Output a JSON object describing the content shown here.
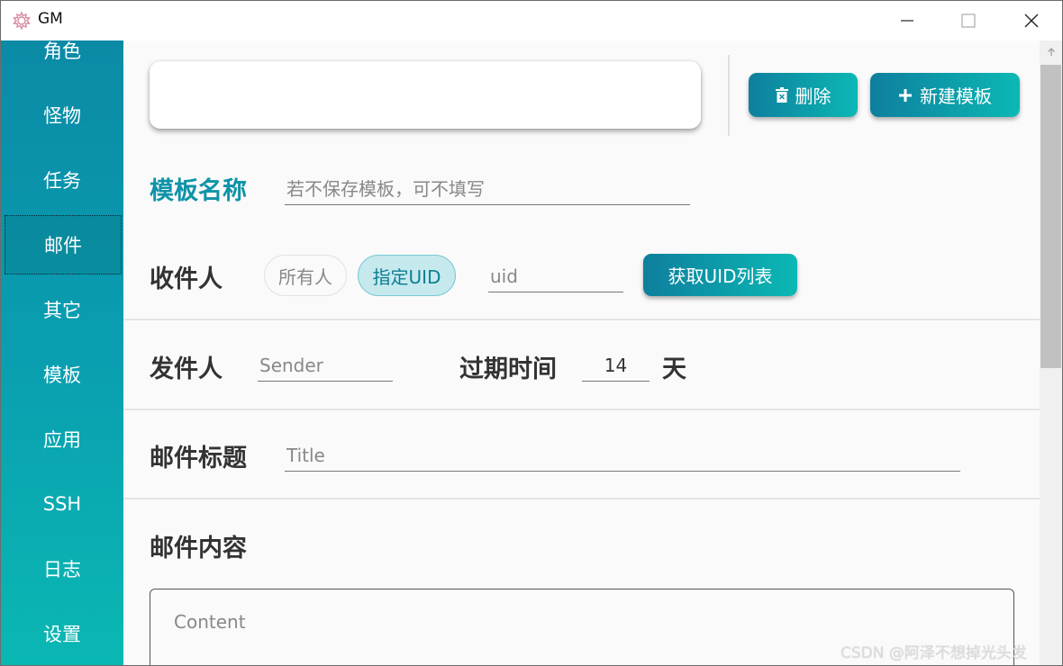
{
  "window": {
    "title": "GM",
    "icon": "gear-flower-icon"
  },
  "sidebar": {
    "items": [
      {
        "label": "角色"
      },
      {
        "label": "怪物"
      },
      {
        "label": "任务"
      },
      {
        "label": "邮件",
        "active": true
      },
      {
        "label": "其它"
      },
      {
        "label": "模板"
      },
      {
        "label": "应用"
      },
      {
        "label": "SSH"
      },
      {
        "label": "日志"
      },
      {
        "label": "设置"
      }
    ]
  },
  "toolbar": {
    "delete_label": "删除",
    "delete_icon": "trash-icon",
    "new_template_label": "新建模板",
    "new_template_icon": "plus-icon"
  },
  "template_name": {
    "label": "模板名称",
    "placeholder": "若不保存模板，可不填写"
  },
  "recipient": {
    "label": "收件人",
    "options": [
      "所有人",
      "指定UID"
    ],
    "selected": "指定UID",
    "uid_placeholder": "uid",
    "get_uid_list_label": "获取UID列表"
  },
  "sender": {
    "label": "发件人",
    "placeholder": "Sender"
  },
  "expiry": {
    "label": "过期时间",
    "value": "14",
    "unit": "天"
  },
  "mail_title": {
    "label": "邮件标题",
    "placeholder": "Title"
  },
  "mail_content": {
    "label": "邮件内容",
    "placeholder": "Content"
  },
  "watermark": "CSDN @阿泽不想掉光头发",
  "colors": {
    "accent_start": "#0e7f9e",
    "accent_end": "#0bb8b4",
    "accent_label": "#0e93a8"
  }
}
